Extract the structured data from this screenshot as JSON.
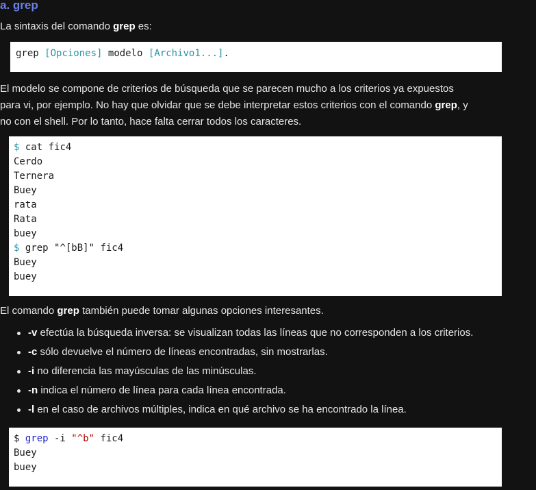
{
  "heading": "a. grep",
  "syntax_intro": {
    "pre": "La sintaxis del comando ",
    "bold": "grep",
    "post": " es:"
  },
  "syntax_code": {
    "cmd": "grep",
    "opts": "[Opciones]",
    "model": "modelo",
    "files": "[Archivo1...]",
    "end": "."
  },
  "model_para": {
    "line1": "El modelo se compone de criterios de búsqueda que se parecen mucho a los criterios ya expuestos",
    "line2_pre": "para vi, por ejemplo. No hay que olvidar que se debe interpretar estos criterios con el comando ",
    "line2_bold": "grep",
    "line2_post": ", y",
    "line3": "no con el shell. Por lo tanto, hace falta cerrar todos los caracteres."
  },
  "example1": {
    "prompt": "$",
    "lines": [
      {
        "prompt": true,
        "text": " cat fic4"
      },
      {
        "prompt": false,
        "text": "Cerdo"
      },
      {
        "prompt": false,
        "text": "Ternera"
      },
      {
        "prompt": false,
        "text": "Buey"
      },
      {
        "prompt": false,
        "text": "rata"
      },
      {
        "prompt": false,
        "text": "Rata"
      },
      {
        "prompt": false,
        "text": "buey"
      },
      {
        "prompt": true,
        "text": " grep \"^[bB]\" fic4"
      },
      {
        "prompt": false,
        "text": "Buey"
      },
      {
        "prompt": false,
        "text": "buey"
      }
    ]
  },
  "options_intro": {
    "pre": "El comando ",
    "bold": "grep",
    "post": " también puede tomar algunas opciones interesantes."
  },
  "options": [
    {
      "flag": "-v",
      "text": " efectúa la búsqueda inversa: se visualizan todas las líneas que no corresponden a los criterios."
    },
    {
      "flag": "-c",
      "text": " sólo devuelve el número de líneas encontradas, sin mostrarlas."
    },
    {
      "flag": "-i",
      "text": " no diferencia las mayúsculas de las minúsculas."
    },
    {
      "flag": "-n",
      "text": " indica el número de línea para cada línea encontrada."
    },
    {
      "flag": "-l",
      "text": " en el caso de archivos múltiples, indica en qué archivo se ha encontrado la línea."
    }
  ],
  "example2": {
    "prompt": "$ ",
    "cmd": "grep",
    "flag": " -i ",
    "pattern": "\"^b\"",
    "file": " fic4",
    "out1": "Buey",
    "out2": "buey"
  }
}
